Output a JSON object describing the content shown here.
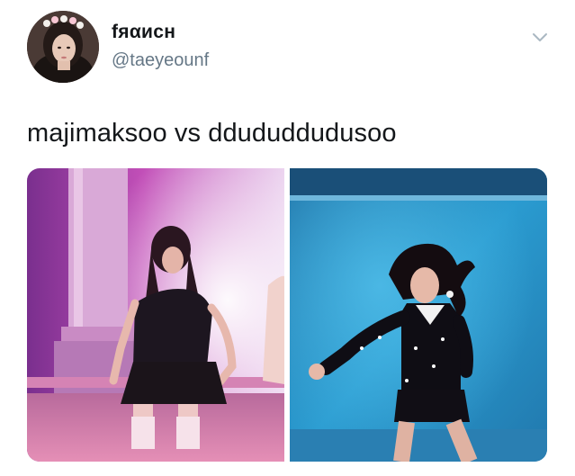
{
  "tweet": {
    "display_name": "fяαиcн",
    "handle": "@taeyeounf",
    "text": "majimaksoo vs ddududdudusoo",
    "menu_icon": "chevron-down-icon",
    "avatar_icon": "profile-photo",
    "media": [
      {
        "name": "photo-left",
        "description_icon": "stage-photo"
      },
      {
        "name": "photo-right",
        "description_icon": "stage-photo"
      }
    ]
  },
  "colors": {
    "text_primary": "#14171a",
    "text_secondary": "#657786",
    "chevron": "#aab8c2"
  }
}
